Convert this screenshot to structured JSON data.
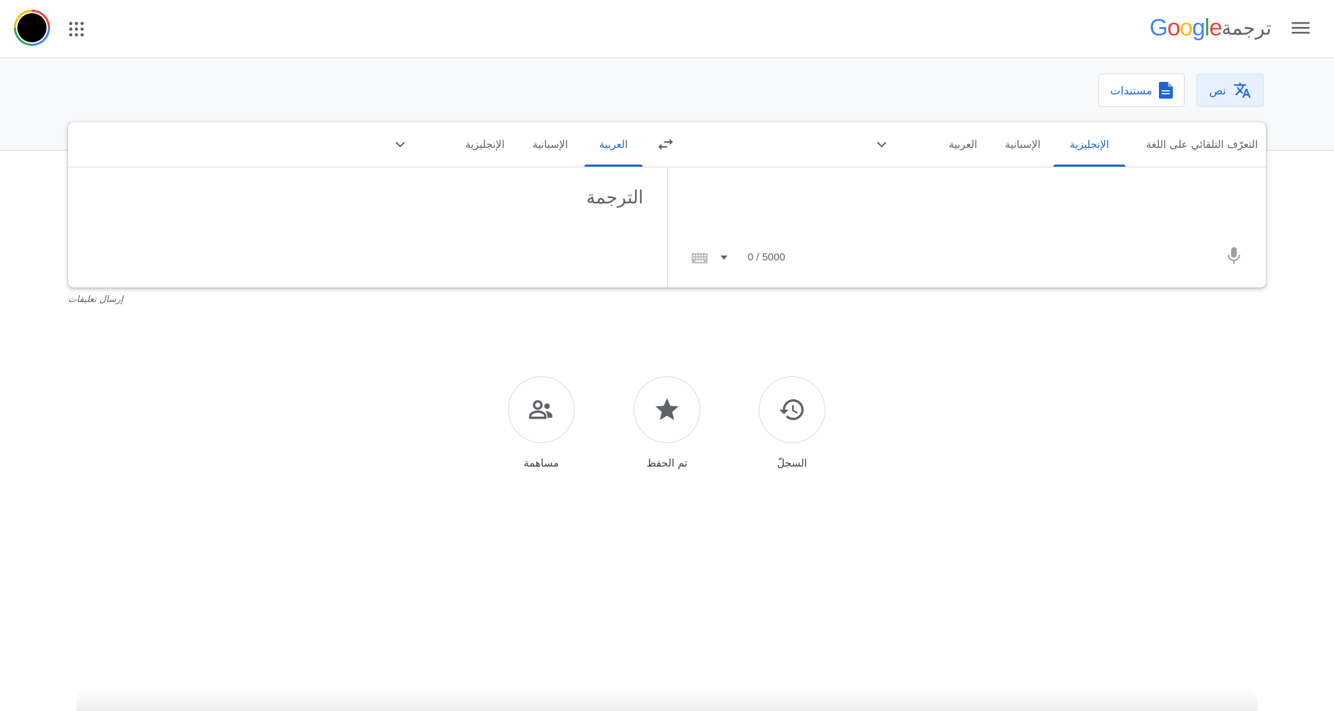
{
  "header": {
    "logo_google": "Google",
    "logo_product": "ترجمة",
    "icons": {
      "menu": "hamburger-menu-icon",
      "apps": "apps-grid-icon",
      "avatar": "account-avatar"
    }
  },
  "modes": {
    "text_label": "نص",
    "docs_label": "مستندات"
  },
  "source_tabs": [
    {
      "label": "التعرّف التلقائي على اللغة",
      "active": false
    },
    {
      "label": "الإنجليزية",
      "active": true
    },
    {
      "label": "الإسبانية",
      "active": false
    },
    {
      "label": "العربية",
      "active": false
    }
  ],
  "target_tabs": [
    {
      "label": "العربية",
      "active": true
    },
    {
      "label": "الإسبانية",
      "active": false
    },
    {
      "label": "الإنجليزية",
      "active": false
    }
  ],
  "translation_placeholder": "الترجمة",
  "char_count": "0 / 5000",
  "feedback_label": "إرسال تعليقات",
  "shortcuts": [
    {
      "label": "السجلّ",
      "icon": "history-icon"
    },
    {
      "label": "تم الحفظ",
      "icon": "star-icon"
    },
    {
      "label": "مساهمة",
      "icon": "community-icon"
    }
  ],
  "colors": {
    "accent": "#1967d2",
    "google_blue": "#4285f4",
    "google_red": "#ea4335",
    "google_yellow": "#fbbc05",
    "google_green": "#34a853"
  }
}
